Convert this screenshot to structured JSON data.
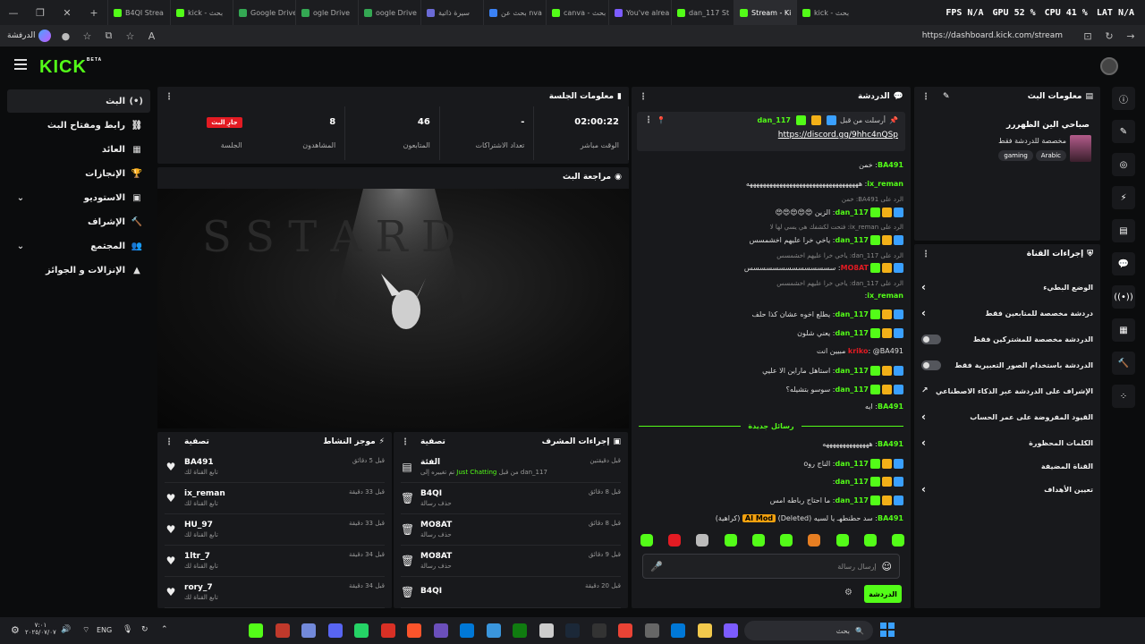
{
  "browser": {
    "tabs": [
      "B4QI Strea",
      "kick - بحث",
      "Google Drive",
      "ogle Drive",
      "oogle Drive",
      "سيرة ذاتية",
      "بحث عن nva",
      "canva - بحث",
      "You've alrea",
      "dan_117 St",
      "Stream - Ki",
      "kick - بحث"
    ],
    "tab_colors": [
      "#53fc18",
      "#53fc18",
      "#34a853",
      "#34a853",
      "#34a853",
      "#6b6bd6",
      "#3b82f6",
      "#53fc18",
      "#7c5cff",
      "#53fc18",
      "#53fc18",
      "#53fc18"
    ],
    "url": "https://dashboard.kick.com/stream",
    "profile_label": "الدرفشة"
  },
  "hud": {
    "fps": "FPS",
    "fps_val": "N/A",
    "gpu": "GPU",
    "gpu_val": "52 %",
    "cpu": "CPU",
    "cpu_val": "41 %",
    "lat": "LAT",
    "lat_val": "N/A"
  },
  "kick": {
    "logo": "KICK",
    "beta": "BETA"
  },
  "nav": {
    "items": [
      {
        "label": "البث",
        "icon": "(•)"
      },
      {
        "label": "رابط ومفتاح البث",
        "icon": "⛓"
      },
      {
        "label": "العائد",
        "icon": "▦"
      },
      {
        "label": "الإنجازات",
        "icon": "🏆"
      },
      {
        "label": "الاستوديو",
        "icon": "▣"
      },
      {
        "label": "الإشراف",
        "icon": "🔨"
      },
      {
        "label": "المجتمع",
        "icon": "👥"
      },
      {
        "label": "الإنزالات و الجوائز",
        "icon": "▲"
      }
    ]
  },
  "session": {
    "title": "معلومات الجلسة",
    "stats": [
      {
        "value": "02:00:22",
        "label": "الوقت مباشر"
      },
      {
        "value": "-",
        "label": "تعداد الاشتراكات"
      },
      {
        "value": "46",
        "label": "المتابعون"
      },
      {
        "value": "8",
        "label": "المشاهدون"
      },
      {
        "value": "جارِ البث",
        "label": "الجلسة"
      }
    ]
  },
  "preview": {
    "title": "مراجعة البث",
    "art_text": "S S T A R D"
  },
  "activity": {
    "title": "موجز النشاط",
    "filter": "تصفية",
    "items": [
      {
        "name": "BA491",
        "sub": "تابع القناة لك",
        "time": "قبل 5 دقائق"
      },
      {
        "name": "ix_reman",
        "sub": "تابع القناة لك",
        "time": "قبل 33 دقيقة"
      },
      {
        "name": "HU_97",
        "sub": "تابع القناة لك",
        "time": "قبل 33 دقيقة"
      },
      {
        "name": "1ltr_7",
        "sub": "تابع القناة لك",
        "time": "قبل 34 دقيقة"
      },
      {
        "name": "rory_7",
        "sub": "تابع القناة لك",
        "time": "قبل 34 دقيقة"
      }
    ]
  },
  "modactions": {
    "title": "إجراءات المشرف",
    "filter": "تصفية",
    "items": [
      {
        "name": "الفئة",
        "sub_prefix": "تم تغييره إلى",
        "sub_cat": "Just Chatting",
        "sub_by": "من قبل dan_117",
        "time": "قبل دقيقتين"
      },
      {
        "name": "B4QI",
        "sub": "حذف رسالة",
        "time": "قبل 8 دقائق"
      },
      {
        "name": "MO8AT",
        "sub": "حذف رسالة",
        "time": "قبل 8 دقائق"
      },
      {
        "name": "MO8AT",
        "sub": "حذف رسالة",
        "time": "قبل 9 دقائق"
      },
      {
        "name": "B4QI",
        "sub": "",
        "time": "قبل 20 دقيقة"
      }
    ]
  },
  "chat": {
    "title": "الدردشة",
    "pinned_by": "أرسلت من قبل",
    "pinned_user": "dan_117",
    "pinned_link": "https://discord.gg/9hhc4nQSp",
    "messages": [
      {
        "user": "BA491",
        "color": "#53fc18",
        "text": "خمن",
        "badges": 0
      },
      {
        "user": "ix_reman",
        "color": "#53fc18",
        "text": "ههههههههههههههههههههههههههههههههههه",
        "badges": 0
      },
      {
        "reply": "الرد على BA491: خمن"
      },
      {
        "user": "dan_117",
        "color": "#53fc18",
        "text": "الزين 😍😍😍😍😍",
        "badges": 3
      },
      {
        "reply": "الرد على ix_reman: فتحت لكشفك هي يسي لها لا"
      },
      {
        "user": "dan_117",
        "color": "#53fc18",
        "text": "ياخي خرا عليهم اخشمسس",
        "badges": 3
      },
      {
        "reply": "الرد على dan_117: ياخي خرا عليهم اخشمسس"
      },
      {
        "user": "MO8AT",
        "color": "#e31b23",
        "text": "سسسسسسسسسسسسسس",
        "badges": 3
      },
      {
        "reply": "الرد على dan_117: ياخي خرا عليهم اخشمسس"
      },
      {
        "user": "ix_reman",
        "color": "#53fc18",
        "text": "",
        "badges": 0
      },
      {
        "user": "dan_117",
        "color": "#53fc18",
        "text": "يطلع اخوه عشان كذا حلف",
        "badges": 3
      },
      {
        "user": "dan_117",
        "color": "#53fc18",
        "text": "يعني شلون",
        "badges": 3
      },
      {
        "user": "kriko",
        "color": "#e31b23",
        "text": "@BA491 مبيين انت",
        "badges": 0
      },
      {
        "user": "dan_117",
        "color": "#53fc18",
        "text": "استاهل ماراين الا عليي",
        "badges": 3
      },
      {
        "user": "dan_117",
        "color": "#53fc18",
        "text": "سوسو بتشيله؟",
        "badges": 3
      },
      {
        "user": "BA491",
        "color": "#53fc18",
        "text": "ايه",
        "badges": 0
      }
    ],
    "new_messages": "رسائل جديدة",
    "new": [
      {
        "user": "BA491",
        "color": "#53fc18",
        "text": "ههههههههههههههه",
        "badges": 0
      },
      {
        "user": "dan_117",
        "color": "#53fc18",
        "text": "الناج روo",
        "badges": 3
      },
      {
        "user": "dan_117",
        "color": "#53fc18",
        "text": "",
        "badges": 3
      },
      {
        "user": "dan_117",
        "color": "#53fc18",
        "text": "ما احتاج رباطه امس",
        "badges": 3
      },
      {
        "user": "BA491",
        "color": "#53fc18",
        "text": "سد حطنطهـ يا لسيه (Deleted)",
        "badges": 0,
        "tag": "AI Mod",
        "extra": "(كراهية)"
      }
    ],
    "input_placeholder": "إرسال رسالة",
    "send": "الدردشة"
  },
  "streaminfo": {
    "title": "معلومات البث",
    "stream_title": "صباحي الين الظهررر",
    "subtitle": "مخصصة للدردشة فقط",
    "tags": [
      "Arabic",
      "gaming"
    ]
  },
  "channelactions": {
    "title": "إجراءات القناة",
    "rows": [
      {
        "label": "الوضع البطيء",
        "type": "arrow"
      },
      {
        "label": "دردشة مخصصة للمتابعين فقط",
        "type": "arrow"
      },
      {
        "label": "الدردشة مخصصة للمشتركين فقط",
        "type": "toggle"
      },
      {
        "label": "الدردشة باستخدام الصور التعبيرية فقط",
        "type": "toggle"
      },
      {
        "label": "الإشراف على الدردشة عبر الذكاء الاصطناعي",
        "type": "ext"
      },
      {
        "label": "القيود المفروضة على عمر الحساب",
        "type": "arrow"
      },
      {
        "label": "الكلمات المحظورة",
        "type": "arrow"
      },
      {
        "label": "القناة المضيفة",
        "type": "none"
      },
      {
        "label": "تعيين الأهداف",
        "type": "arrow"
      }
    ]
  },
  "taskbar": {
    "time": "٧:٠١",
    "date": "٢٠٢٥/٠٧/٠٧",
    "lang": "ENG",
    "search": "بحث"
  }
}
